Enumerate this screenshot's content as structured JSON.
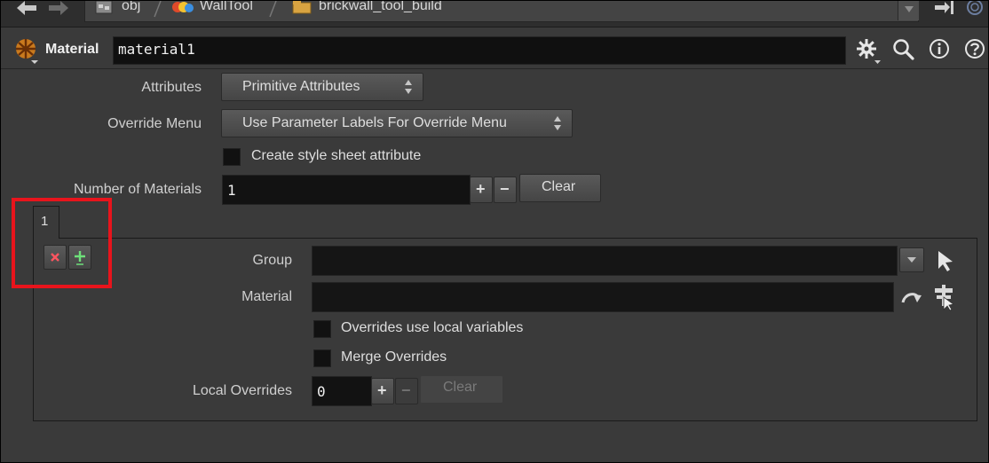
{
  "path_bar": {
    "crumbs": [
      {
        "label": "obj",
        "icon": "network-icon"
      },
      {
        "label": "WallTool",
        "icon": "subnet-icon"
      },
      {
        "label": "brickwall_tool_build",
        "icon": "folder-icon"
      }
    ]
  },
  "node": {
    "type_label": "Material",
    "name": "material1"
  },
  "params": {
    "attributes_label": "Attributes",
    "attributes_value": "Primitive Attributes",
    "override_menu_label": "Override Menu",
    "override_menu_value": "Use Parameter Labels For Override Menu",
    "style_sheet_label": "Create style sheet attribute",
    "num_materials_label": "Number of Materials",
    "num_materials_value": "1",
    "plus": "+",
    "minus": "−",
    "clear_label": "Clear"
  },
  "multiparm": {
    "tab_label": "1",
    "remove_glyph": "×",
    "insert_glyph": "+",
    "group_label": "Group",
    "group_value": "",
    "material_label": "Material",
    "material_value": "",
    "overrides_local_label": "Overrides use local variables",
    "merge_overrides_label": "Merge Overrides",
    "local_overrides_label": "Local Overrides",
    "local_overrides_value": "0",
    "plus": "+",
    "minus": "−",
    "clear_label": "Clear"
  },
  "colors": {
    "highlight_box": "#e8141c",
    "panel": "#3a3a3a",
    "field": "#151515"
  }
}
